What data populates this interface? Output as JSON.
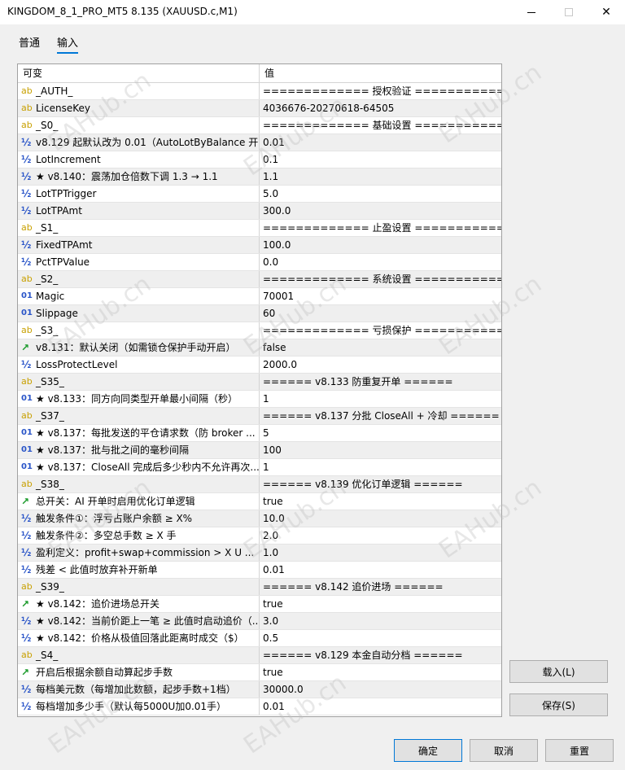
{
  "window": {
    "title": "KINGDOM_8_1_PRO_MT5 8.135 (XAUUSD.c,M1)",
    "min_glyph": "",
    "close_glyph": "✕"
  },
  "tabs": [
    {
      "label": "普通",
      "active": false
    },
    {
      "label": "输入",
      "active": true
    }
  ],
  "grid": {
    "columns": [
      "可变",
      "值"
    ],
    "rows": [
      {
        "icon": "ab",
        "name": "_AUTH_",
        "value": "============= 授权验证 =============="
      },
      {
        "icon": "ab",
        "name": "LicenseKey",
        "value": "4036676-20270618-64505"
      },
      {
        "icon": "ab",
        "name": "_S0_",
        "value": "============= 基础设置 =============="
      },
      {
        "icon": "½",
        "name": "v8.129 起默认改为 0.01（AutoLotByBalance 开...",
        "value": "0.01"
      },
      {
        "icon": "½",
        "name": "LotIncrement",
        "value": "0.1"
      },
      {
        "icon": "½",
        "name": "★ v8.140：震荡加仓倍数下调 1.3 → 1.1",
        "value": "1.1"
      },
      {
        "icon": "½",
        "name": "LotTPTrigger",
        "value": "5.0"
      },
      {
        "icon": "½",
        "name": "LotTPAmt",
        "value": "300.0"
      },
      {
        "icon": "ab",
        "name": "_S1_",
        "value": "============= 止盈设置 =============="
      },
      {
        "icon": "½",
        "name": "FixedTPAmt",
        "value": "100.0"
      },
      {
        "icon": "½",
        "name": "PctTPValue",
        "value": "0.0"
      },
      {
        "icon": "ab",
        "name": "_S2_",
        "value": "============= 系统设置 =============="
      },
      {
        "icon": "01",
        "name": "Magic",
        "value": "70001"
      },
      {
        "icon": "01",
        "name": "Slippage",
        "value": "60"
      },
      {
        "icon": "ab",
        "name": "_S3_",
        "value": "============= 亏损保护 =============="
      },
      {
        "icon": "bool",
        "name": "v8.131：默认关闭（如需锁仓保护手动开启）",
        "value": "false"
      },
      {
        "icon": "½",
        "name": "LossProtectLevel",
        "value": "2000.0"
      },
      {
        "icon": "ab",
        "name": "_S35_",
        "value": "====== v8.133 防重复开单 ======"
      },
      {
        "icon": "01",
        "name": "★ v8.133：同方向同类型开单最小间隔（秒）",
        "value": "1"
      },
      {
        "icon": "ab",
        "name": "_S37_",
        "value": "====== v8.137 分批 CloseAll + 冷却 ======"
      },
      {
        "icon": "01",
        "name": "★ v8.137：每批发送的平仓请求数（防 broker ...",
        "value": "5"
      },
      {
        "icon": "01",
        "name": "★ v8.137：批与批之间的毫秒间隔",
        "value": "100"
      },
      {
        "icon": "01",
        "name": "★ v8.137：CloseAll 完成后多少秒内不允许再次...",
        "value": "1"
      },
      {
        "icon": "ab",
        "name": "_S38_",
        "value": "====== v8.139 优化订单逻辑 ======"
      },
      {
        "icon": "bool",
        "name": "总开关：AI 开单时启用优化订单逻辑",
        "value": "true"
      },
      {
        "icon": "½",
        "name": "触发条件①：浮亏占账户余额 ≥ X%",
        "value": "10.0"
      },
      {
        "icon": "½",
        "name": "触发条件②：多空总手数 ≥ X 手",
        "value": "2.0"
      },
      {
        "icon": "½",
        "name": "盈利定义：profit+swap+commission > X U ...",
        "value": "1.0"
      },
      {
        "icon": "½",
        "name": "残差 < 此值时放弃补开新单",
        "value": "0.01"
      },
      {
        "icon": "ab",
        "name": "_S39_",
        "value": "====== v8.142 追价进场 ======"
      },
      {
        "icon": "bool",
        "name": "★ v8.142：追价进场总开关",
        "value": "true"
      },
      {
        "icon": "½",
        "name": "★ v8.142：当前价距上一笔 ≥ 此值时启动追价（...",
        "value": "3.0"
      },
      {
        "icon": "½",
        "name": "★ v8.142：价格从极值回落此距离时成交（$）",
        "value": "0.5"
      },
      {
        "icon": "ab",
        "name": "_S4_",
        "value": "====== v8.129 本金自动分档 ======"
      },
      {
        "icon": "bool",
        "name": "开启后根据余额自动算起步手数",
        "value": "true"
      },
      {
        "icon": "½",
        "name": "每档美元数（每增加此数额，起步手数+1档）",
        "value": "30000.0"
      },
      {
        "icon": "½",
        "name": "每档增加多少手（默认每5000U加0.01手）",
        "value": "0.01"
      }
    ]
  },
  "buttons": {
    "load": "载入(L)",
    "save": "保存(S)",
    "ok": "确定",
    "cancel": "取消",
    "reset": "重置"
  },
  "watermark": "EAHub.cn"
}
